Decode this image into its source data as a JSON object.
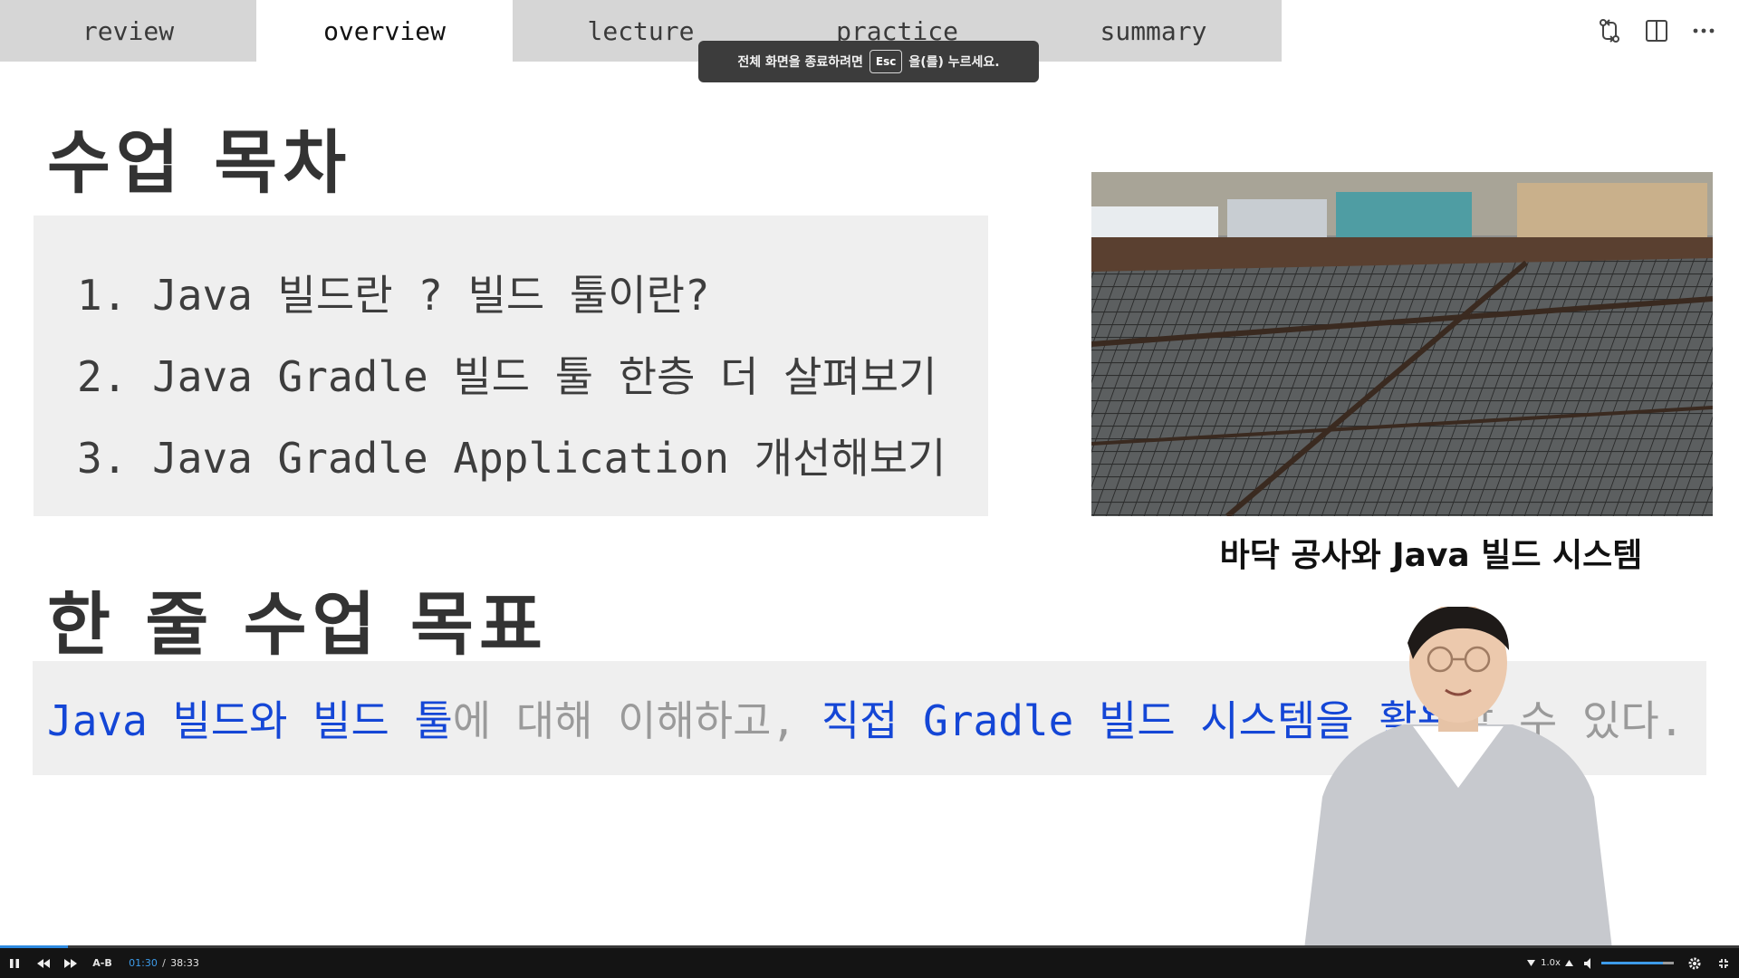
{
  "tabs": [
    {
      "label": "review"
    },
    {
      "label": "overview"
    },
    {
      "label": "lecture"
    },
    {
      "label": "practice"
    },
    {
      "label": "summary"
    }
  ],
  "active_tab": "overview",
  "tab_icons": [
    "compare-changes-icon",
    "split-editor-icon",
    "more-actions-icon"
  ],
  "toast": {
    "before": "전체 화면을 종료하려면",
    "key": "Esc",
    "after": "을(를) 누르세요."
  },
  "slide": {
    "toc_title": "수업 목차",
    "toc_items": [
      "1. Java 빌드란 ? 빌드 툴이란?",
      "2. Java Gradle 빌드 툴 한층 더 살펴보기",
      "3. Java Gradle Application 개선해보기"
    ],
    "image_caption": "바닥 공사와 Java 빌드 시스템",
    "goal_title": "한 줄 수업 목표",
    "goal_segments": [
      {
        "text": "Java 빌드와 빌드 툴",
        "highlight": true
      },
      {
        "text": "에 대해 이해하고, ",
        "highlight": false
      },
      {
        "text": "직접 Gradle 빌드 시스템을 활용",
        "highlight": true
      },
      {
        "text": "할 수 있다.",
        "highlight": false
      }
    ]
  },
  "player": {
    "ab_label": "A-B",
    "current_time": "01:30",
    "time_separator": "/",
    "total_time": "38:33",
    "progress": 0.039,
    "speed": "1.0x",
    "volume": 0.85
  },
  "colors": {
    "accent_blue": "#1446d6",
    "muted_text": "#9a9a9a",
    "tab_inactive_bg": "#d6d6d6",
    "player_bg": "#141414",
    "player_accent": "#3d9be9"
  }
}
